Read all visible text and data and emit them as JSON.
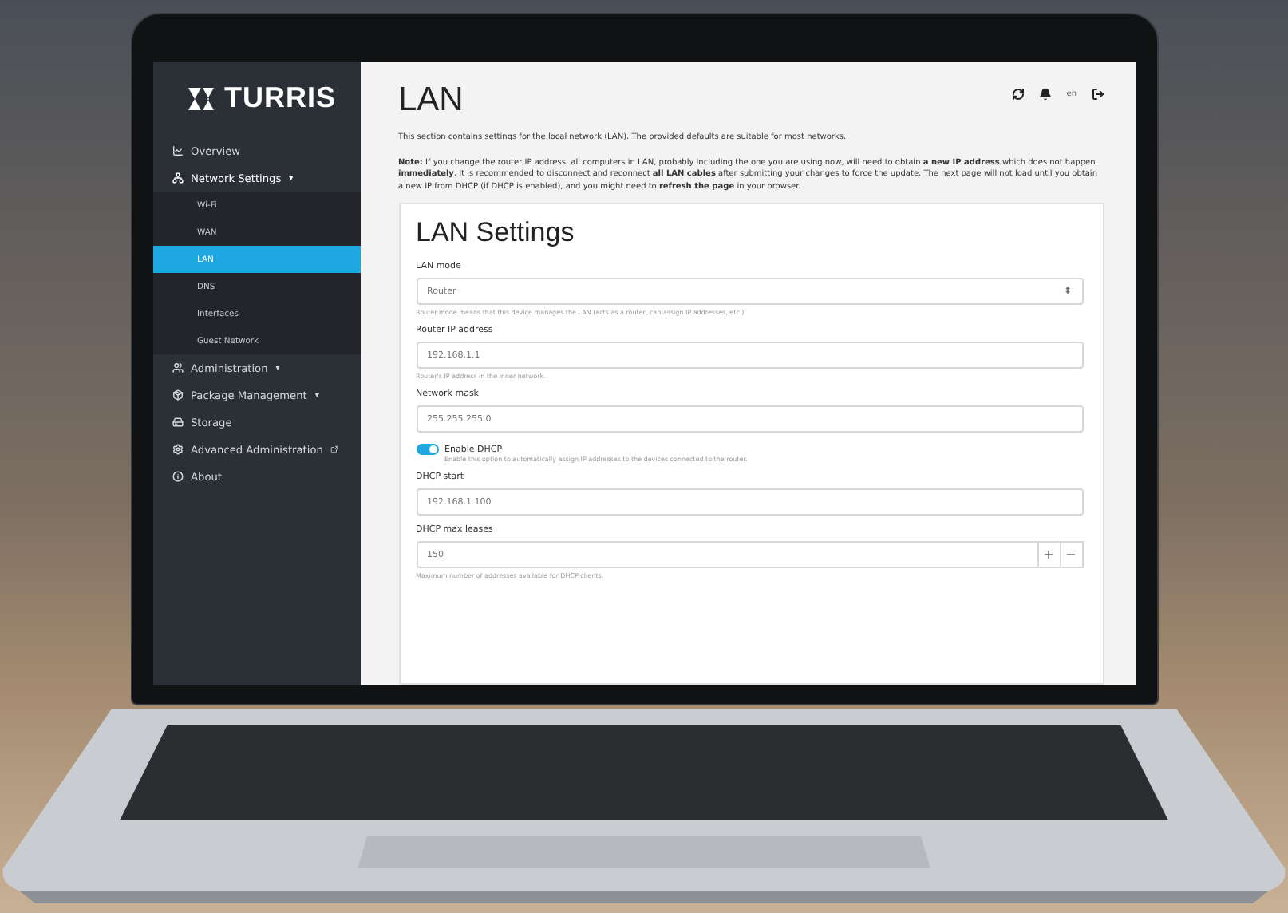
{
  "logo": {
    "text": "TURRIS"
  },
  "sidebar": {
    "items": [
      {
        "label": "Overview",
        "selected": false
      },
      {
        "label": "Network Settings",
        "selected": false,
        "expanded": true,
        "caret": "▾",
        "children": [
          {
            "label": "Wi-Fi",
            "selected": false
          },
          {
            "label": "WAN",
            "selected": false
          },
          {
            "label": "LAN",
            "selected": true
          },
          {
            "label": "DNS",
            "selected": false
          },
          {
            "label": "Interfaces",
            "selected": false
          },
          {
            "label": "Guest Network",
            "selected": false
          }
        ]
      },
      {
        "label": "Administration",
        "selected": false,
        "caret": "▾"
      },
      {
        "label": "Package Management",
        "selected": false,
        "caret": "▾"
      },
      {
        "label": "Storage",
        "selected": false
      },
      {
        "label": "Advanced Administration",
        "selected": false,
        "external": true
      },
      {
        "label": "About",
        "selected": false
      }
    ]
  },
  "header": {
    "title": "LAN",
    "language": "en"
  },
  "intro": "This section contains settings for the local network (LAN). The provided defaults are suitable for most networks.",
  "note": "**Note:** If you change the router IP address, all computers in LAN, probably including the one you are using now, will need to obtain **a new IP address** which does not happen **immediately**. It is recommended to disconnect and reconnect **all LAN cables** after submitting your changes to force the update. The next page will not load until you obtain a new IP from DHCP (if DHCP is enabled), and you might need to **refresh the page** in your browser.",
  "card": {
    "title": "LAN Settings",
    "fields": [
      {
        "kind": "select",
        "label": "LAN mode",
        "value": "Router",
        "caret": "⬍",
        "help": "Router mode means that this device manages the LAN (acts as a router, can assign IP addresses, etc.)."
      },
      {
        "kind": "text",
        "label": "Router IP address",
        "value": "192.168.1.1",
        "help": "Router's IP address in the inner network."
      },
      {
        "kind": "text",
        "label": "Network mask",
        "value": "255.255.255.0"
      },
      {
        "kind": "switch",
        "label": "Enable DHCP",
        "on": true,
        "help": "Enable this option to automatically assign IP addresses to the devices connected to the router."
      },
      {
        "kind": "text",
        "label": "DHCP start",
        "value": "192.168.1.100"
      },
      {
        "kind": "number",
        "label": "DHCP max leases",
        "value": "150",
        "plus": "+",
        "minus": "−",
        "help": "Maximum number of addresses available for DHCP clients."
      }
    ]
  }
}
